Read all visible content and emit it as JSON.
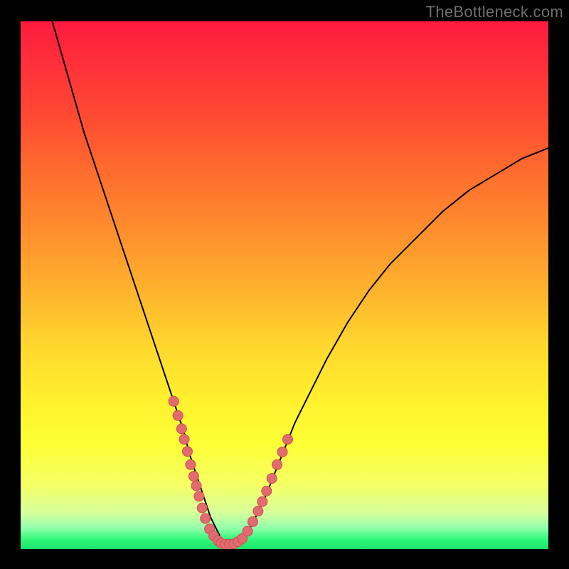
{
  "watermark": "TheBottleneck.com",
  "colors": {
    "frame": "#000000",
    "curve": "#000000",
    "dot_fill": "#e26b6f",
    "dot_stroke": "#c94f55"
  },
  "chart_data": {
    "type": "line",
    "title": "",
    "xlabel": "",
    "ylabel": "",
    "xlim": [
      0,
      100
    ],
    "ylim": [
      0,
      100
    ],
    "series": [
      {
        "name": "bottleneck-curve",
        "x": [
          6,
          8,
          10,
          12,
          14,
          16,
          18,
          20,
          22,
          24,
          26,
          28,
          29,
          30,
          31,
          32,
          33,
          34,
          35,
          36,
          37,
          38,
          39,
          40,
          41,
          42,
          43,
          44,
          46,
          48,
          50,
          52,
          55,
          58,
          62,
          66,
          70,
          75,
          80,
          85,
          90,
          95,
          100
        ],
        "y": [
          100,
          93,
          86,
          79,
          73,
          67,
          61,
          55,
          49,
          43,
          37,
          31,
          28,
          25,
          22,
          18,
          15,
          12,
          9,
          6,
          4,
          2,
          1,
          1,
          1,
          2,
          3,
          5,
          9,
          14,
          19,
          24,
          30,
          36,
          43,
          49,
          54,
          59,
          64,
          68,
          71,
          74,
          76
        ]
      }
    ],
    "dots": {
      "name": "highlight-dots",
      "x": [
        29.0,
        29.8,
        30.5,
        31.0,
        31.6,
        32.2,
        32.8,
        33.3,
        33.8,
        34.4,
        35.0,
        35.8,
        36.6,
        37.4,
        38.0,
        38.8,
        39.6,
        40.4,
        41.2,
        42.0,
        43.0,
        44.0,
        45.0,
        45.8,
        46.6,
        47.6,
        48.6,
        49.6,
        50.6
      ],
      "y": [
        28.0,
        25.3,
        22.8,
        20.8,
        18.5,
        16.0,
        13.8,
        12.0,
        10.0,
        7.8,
        5.8,
        3.8,
        2.5,
        1.6,
        1.1,
        0.9,
        0.9,
        1.0,
        1.4,
        2.0,
        3.4,
        5.2,
        7.2,
        9.0,
        11.0,
        13.4,
        16.0,
        18.4,
        20.8
      ]
    }
  }
}
